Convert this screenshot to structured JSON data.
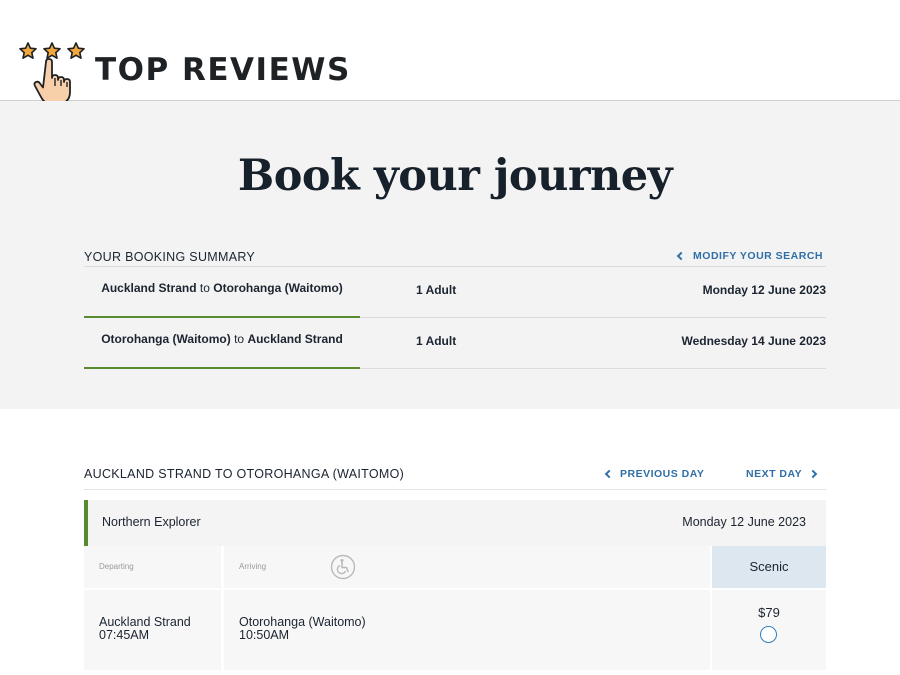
{
  "header": {
    "brand": "TOP REVIEWS",
    "logo_icon": "three-stars-pointing-hand-icon"
  },
  "page": {
    "title": "Book your journey"
  },
  "summary": {
    "label": "YOUR BOOKING SUMMARY",
    "modify_link": "MODIFY YOUR SEARCH",
    "legs": [
      {
        "from": "Auckland Strand",
        "connector": "to",
        "to": "Otorohanga (Waitomo)",
        "passengers": "1 Adult",
        "date": "Monday 12 June 2023"
      },
      {
        "from": "Otorohanga (Waitomo)",
        "connector": "to",
        "to": "Auckland Strand",
        "passengers": "1 Adult",
        "date": "Wednesday 14 June 2023"
      }
    ]
  },
  "results": {
    "title": "AUCKLAND STRAND TO OTOROHANGA (WAITOMO)",
    "previous_day": "PREVIOUS DAY",
    "next_day": "NEXT DAY",
    "service": {
      "name": "Northern Explorer",
      "date": "Monday 12 June 2023"
    },
    "columns": {
      "departing": "Departing",
      "arriving": "Arriving",
      "accessibility_icon": "wheelchair-icon",
      "fare_class": "Scenic"
    },
    "rows": [
      {
        "departing_place": "Auckland Strand",
        "departing_time": "07:45AM",
        "arriving_place": "Otorohanga (Waitomo)",
        "arriving_time": "10:50AM",
        "price": "$79"
      }
    ]
  },
  "colors": {
    "accent_green": "#5a8a2e",
    "link_blue": "#2f6fa6",
    "fare_header_bg": "#dce7f0",
    "hero_bg": "#f3f3f3"
  }
}
